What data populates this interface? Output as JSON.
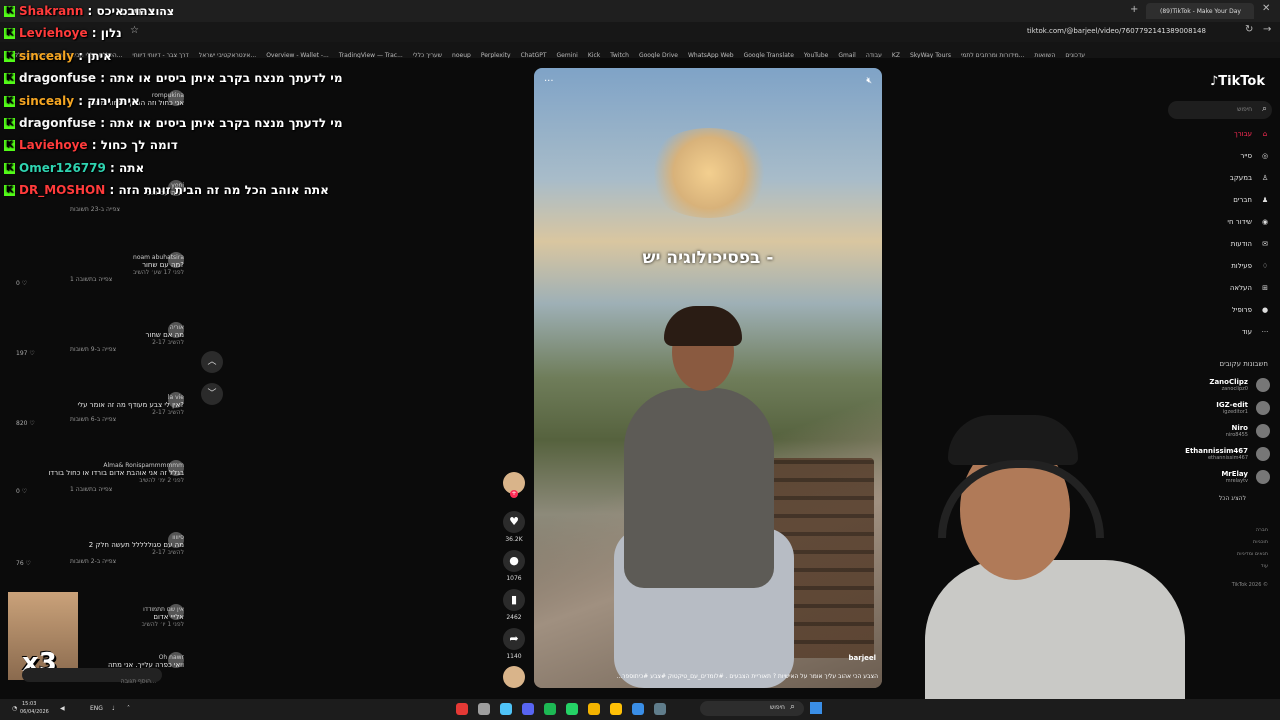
{
  "browser": {
    "tab_left_label": "צהוב איכס",
    "tab_active_title": "(89)TikTok - Make Your Day",
    "url": "tiktok.com/@barjeel/video/7607792141389008148",
    "bookmarks": [
      "סבתא נטפלקס",
      "הכללת כללי הבינה הת...",
      "דרך צבר - דיווחי דיווחי",
      "אינטראקטיבי ישראל...",
      "Overview - Wallet -...",
      "TradingView — Trac...",
      "שעריך כללי",
      "noeup",
      "Perplexity",
      "ChatGPT",
      "Gemini",
      "Kick",
      "Twitch",
      "Google Drive",
      "WhatsApp Web",
      "Google Translate",
      "YouTube",
      "Gmail",
      "עבודה",
      "KZ",
      "SkyWay Tours",
      "מידורות ומרחבים לתמי...",
      "השוואות",
      "עדכונים"
    ]
  },
  "stream_chat": [
    {
      "user": "Shakrann",
      "msg": "צהוב איכס",
      "color": "#ff3b3b"
    },
    {
      "user": "Leviehoye",
      "msg": "נלון",
      "color": "#ff3b3b"
    },
    {
      "user": "sincealy",
      "msg": "איתן",
      "color": "#f5a623"
    },
    {
      "user": "dragonfuse",
      "msg": "מי לדעתך מנצח בקרב איתן ביסים או אתה",
      "color": "#f5f5f5"
    },
    {
      "user": "sincealy",
      "msg": "איתן ירוק",
      "color": "#f5a623"
    },
    {
      "user": "dragonfuse",
      "msg": "מי לדעתך מנצח בקרב איתן ביסים או אתה",
      "color": "#f5f5f5"
    },
    {
      "user": "Laviehoye",
      "msg": "דומה לך כחול",
      "color": "#ff3b3b"
    },
    {
      "user": "Omer126779",
      "msg": "אתה",
      "color": "#2fd3b0"
    },
    {
      "user": "DR_MOSHON",
      "msg": "אתה אוהב הכל מה זה הבית זונות הזה",
      "color": "#ff3b3b"
    }
  ],
  "comments": [
    {
      "user": "rompukina",
      "text": "אני כחול וזה ההפך הגמור ממני",
      "meta": ""
    },
    {
      "user": "yoni",
      "text": "מה עם טוב?",
      "meta": ""
    },
    {
      "thread": "צפייה ב-23 תשובות"
    },
    {
      "user": "noam abuhatsira",
      "text": "מה עם שחור?",
      "meta": "לפני 17 שע׳  להשיב",
      "likes": "0"
    },
    {
      "thread": "צפייה בתשובה 1"
    },
    {
      "user": "אוריה",
      "text": "מה אם שחור",
      "meta": "2-17  להשיב",
      "likes": "197"
    },
    {
      "thread": "צפייה ב-9 תשובות"
    },
    {
      "user": "la vie",
      "text": "אין לי צבע מעודף מה זה אומר עלי?",
      "meta": "2-17  להשיב",
      "likes": "820"
    },
    {
      "thread": "צפייה ב-6 תשובות"
    },
    {
      "user": "Alma& Ronispammmmmm",
      "text": "בגלל זה אני אוהבת אדום בורדו או כחול בורדו",
      "meta": "לפני 2 ימ׳  להשיב",
      "likes": "0"
    },
    {
      "thread": "צפייה בתשובה 1"
    },
    {
      "user": "סיוווו",
      "text": "מה עם סגוללללל תעשה חלק 2",
      "meta": "2-17  להשיב",
      "likes": "76"
    },
    {
      "thread": "צפייה ב-2 תשובות"
    },
    {
      "user": "אין שם תתמודדו",
      "text": "אלייי אדום",
      "meta": "לפני 1 יו׳  להשיב"
    },
    {
      "user": "Oh nawr",
      "text": "וואי כפרה עלייך. אני מתה",
      "meta": ""
    }
  ],
  "comment_input_placeholder": "הוסף תגובה...",
  "video": {
    "overlay_text": "בפסיכולוגיה יש -",
    "author": "barjeel",
    "caption": "...הצבע הכי אהוב עליך אומר על האישיות ? תאוריית הצבעים . #לומדים_עם_טיקטוק #צבע #כיתוספר"
  },
  "actions": {
    "likes": "36.2K",
    "comments": "1076",
    "saves": "2462",
    "shares": "1140"
  },
  "tiktok": {
    "logo": "TikTok",
    "search_placeholder": "חיפוש",
    "nav": [
      {
        "label": "עבורך",
        "icon": "home-icon"
      },
      {
        "label": "סייר",
        "icon": "compass-icon"
      },
      {
        "label": "במעקב",
        "icon": "following-icon"
      },
      {
        "label": "חברים",
        "icon": "friends-icon"
      },
      {
        "label": "שידור חי",
        "icon": "live-icon"
      },
      {
        "label": "הודעות",
        "icon": "messages-icon"
      },
      {
        "label": "פעילות",
        "icon": "activity-icon"
      },
      {
        "label": "העלאה",
        "icon": "upload-icon"
      },
      {
        "label": "פרופיל",
        "icon": "profile-icon"
      },
      {
        "label": "עוד",
        "icon": "more-icon"
      }
    ],
    "following_title": "חשבונות עקובים",
    "following": [
      {
        "name": "ZanoClipz",
        "handle": "zanoclipz0"
      },
      {
        "name": "IGZ-edit",
        "handle": "igzeditor1"
      },
      {
        "name": "Niro",
        "handle": "niro8455"
      },
      {
        "name": "Ethannissim467",
        "handle": "ethannissim467"
      },
      {
        "name": "MrElay",
        "handle": "mrelaytv"
      }
    ],
    "show_all": "להציג הכל",
    "footer": [
      "חברה",
      "תוכניות",
      "תנאים ומדיניות",
      "עוד"
    ],
    "copyright": "TikTok 2026 ©"
  },
  "taskbar": {
    "time": "15:03",
    "date": "06/04/2026",
    "lang": "ENG",
    "search_label": "חיפוש"
  }
}
